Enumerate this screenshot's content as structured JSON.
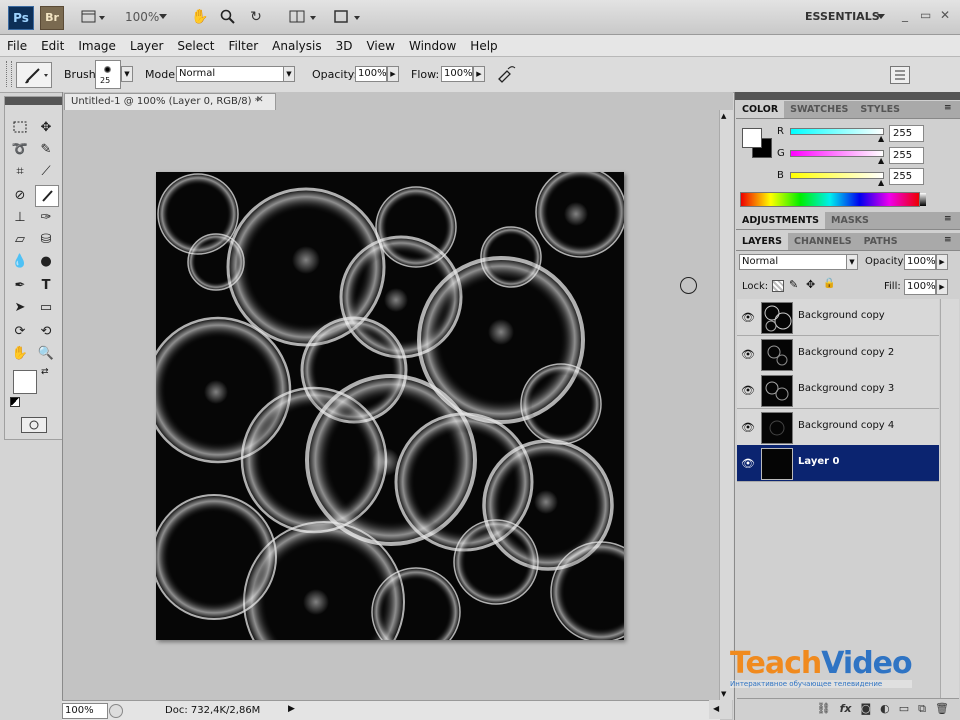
{
  "appbar": {
    "ps_logo": "Ps",
    "br_logo": "Br",
    "zoom": "100%",
    "workspace": "ESSENTIALS",
    "win_min": "_",
    "win_restore": "▭",
    "win_close": "✕"
  },
  "menu": [
    "File",
    "Edit",
    "Image",
    "Layer",
    "Select",
    "Filter",
    "Analysis",
    "3D",
    "View",
    "Window",
    "Help"
  ],
  "options": {
    "brush_label": "Brush:",
    "brush_size": "25",
    "mode_label": "Mode:",
    "mode_value": "Normal",
    "opacity_label": "Opacity:",
    "opacity_value": "100%",
    "flow_label": "Flow:",
    "flow_value": "100%"
  },
  "document": {
    "tab_title": "Untitled-1 @ 100% (Layer 0, RGB/8) *",
    "tab_close": "✕",
    "zoom_status": "100%",
    "doc_status": "Doc: 732,4K/2,86M"
  },
  "color_panel": {
    "tabs": [
      "COLOR",
      "SWATCHES",
      "STYLES"
    ],
    "r_label": "R",
    "g_label": "G",
    "b_label": "B",
    "r_value": "255",
    "g_value": "255",
    "b_value": "255"
  },
  "adjust_panel": {
    "tabs": [
      "ADJUSTMENTS",
      "MASKS"
    ]
  },
  "layers_panel": {
    "tabs": [
      "LAYERS",
      "CHANNELS",
      "PATHS"
    ],
    "blend_mode": "Normal",
    "opacity_label": "Opacity:",
    "opacity_value": "100%",
    "lock_label": "Lock:",
    "fill_label": "Fill:",
    "fill_value": "100%",
    "layers": [
      {
        "name": "Background copy"
      },
      {
        "name": "Background copy 2"
      },
      {
        "name": "Background copy 3"
      },
      {
        "name": "Background copy 4"
      },
      {
        "name": "Layer 0"
      }
    ]
  },
  "watermark": {
    "brand_teach": "Teach",
    "brand_video": "Video",
    "tagline": "Интерактивное обучающее телевидение"
  },
  "colors": {
    "selected_layer": "#0b2470",
    "brand_orange": "#f08a1e",
    "brand_blue": "#2f74c4"
  }
}
